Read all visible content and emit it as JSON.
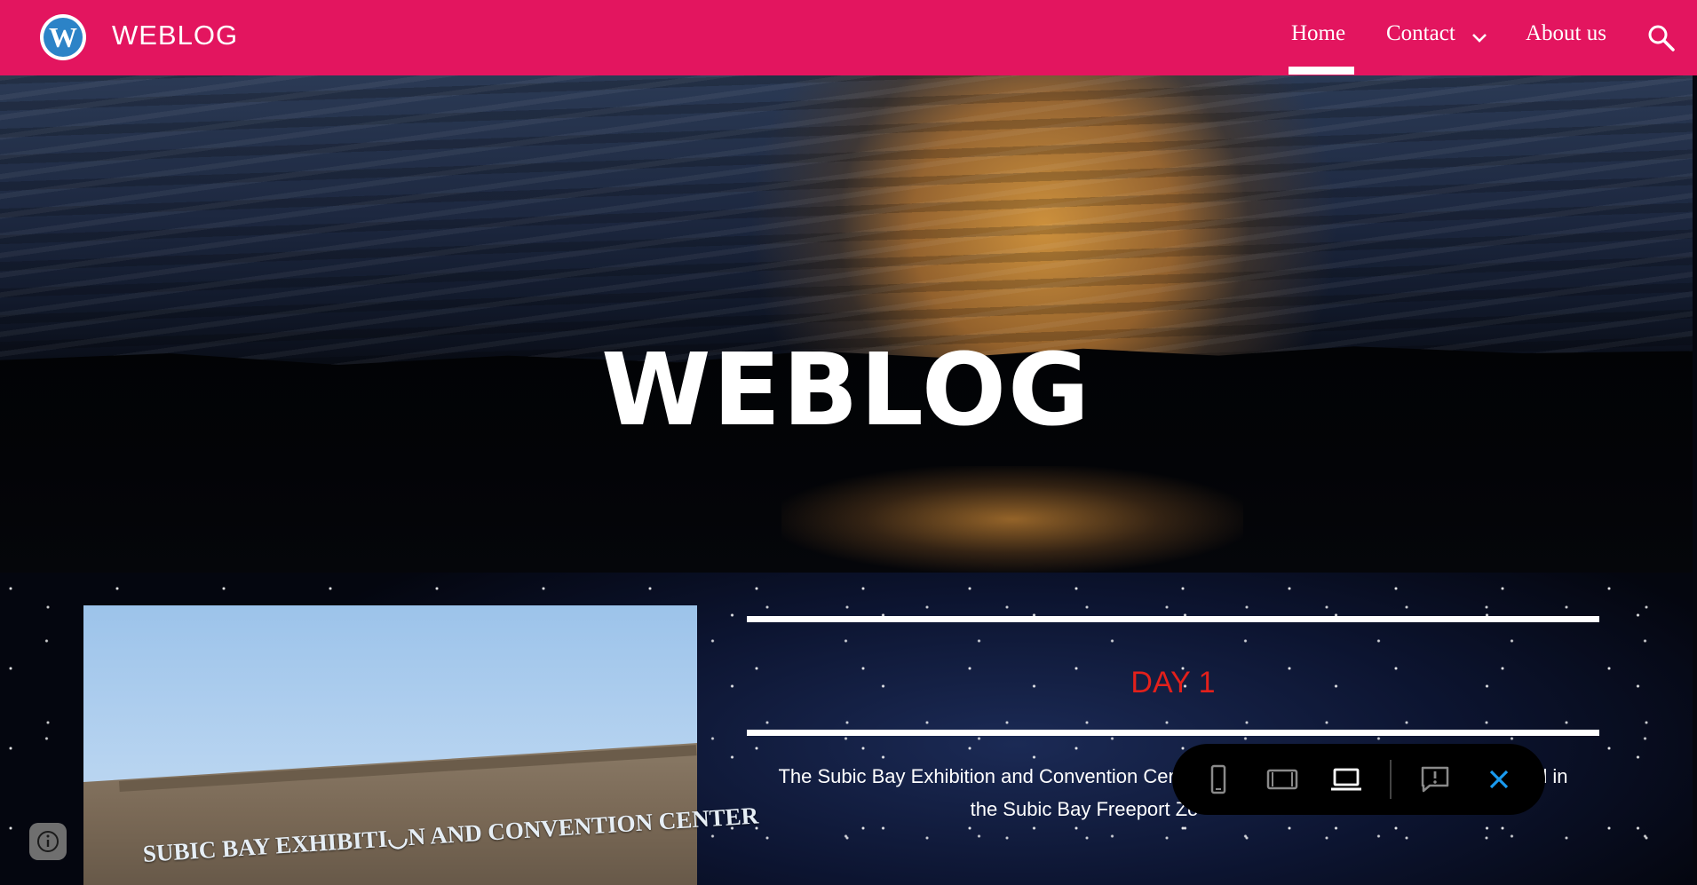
{
  "site": {
    "name": "WEBLOG"
  },
  "nav": {
    "items": [
      {
        "label": "Home",
        "active": true
      },
      {
        "label": "Contact",
        "has_dropdown": true
      },
      {
        "label": "About us"
      }
    ],
    "search_icon": "search-icon"
  },
  "hero": {
    "title": "WEBLOG"
  },
  "post": {
    "photo_sign": "SUBIC BAY EXHIBITI◡N AND CONVENTION CENTER",
    "heading": "DAY 1",
    "body_line1": "The Subic Bay Exhibition and Convention Cer",
    "body_line1_end": "ed in",
    "body_line2": "the Subic Bay Freeport Zo"
  },
  "preview_toolbar": {
    "buttons": [
      "phone-view-icon",
      "tablet-view-icon",
      "laptop-view-icon",
      "report-icon",
      "close-icon"
    ],
    "active": "laptop-view-icon"
  },
  "colors": {
    "header_bg": "#e3155f",
    "day_heading": "#e3201b",
    "close_icon": "#1a9bf0"
  }
}
